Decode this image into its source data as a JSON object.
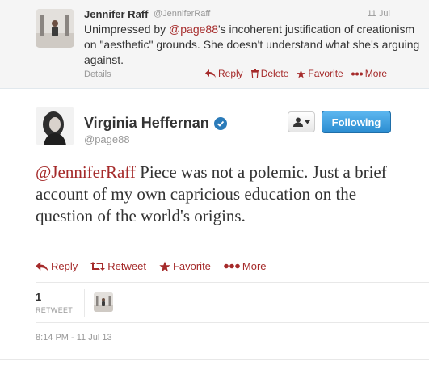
{
  "parent_tweet": {
    "name": "Jennifer Raff",
    "handle": "@JenniferRaff",
    "time": "11 Jul",
    "text_before": "Unimpressed by ",
    "mention": "@page88",
    "text_after": "'s incoherent justification of creationism on \"aesthetic\" grounds. She doesn't understand what she's arguing against.",
    "details_label": "Details",
    "actions": {
      "reply": "Reply",
      "delete": "Delete",
      "favorite": "Favorite",
      "more": "More"
    }
  },
  "main_tweet": {
    "name": "Virginia Heffernan",
    "handle": "@page88",
    "follow_label": "Following",
    "mention": "@JenniferRaff",
    "text": " Piece was not a polemic. Just a brief account of my own capricious education on the question of the world's origins.",
    "actions": {
      "reply": "Reply",
      "retweet": "Retweet",
      "favorite": "Favorite",
      "more": "More"
    },
    "retweet_count": "1",
    "retweet_label": "RETWEET",
    "timestamp": "8:14 PM - 11 Jul 13"
  },
  "colors": {
    "link": "#a52a2a",
    "follow_button": "#2b8dd1",
    "verified": "#2b7bb9",
    "muted": "#999999"
  },
  "icons": [
    "reply-icon",
    "delete-icon",
    "favorite-icon",
    "more-icon",
    "retweet-icon",
    "verified-icon",
    "user-icon"
  ]
}
